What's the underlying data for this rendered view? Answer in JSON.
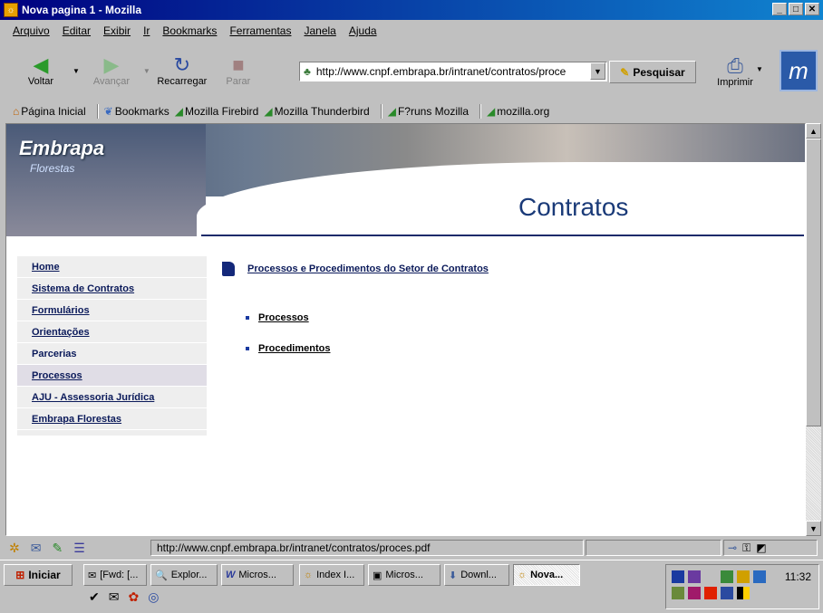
{
  "window": {
    "title": "Nova pagina 1 - Mozilla",
    "min": "_",
    "max": "□",
    "close": "✕"
  },
  "menu": [
    "Arquivo",
    "Editar",
    "Exibir",
    "Ir",
    "Bookmarks",
    "Ferramentas",
    "Janela",
    "Ajuda"
  ],
  "toolbar": {
    "back": "Voltar",
    "forward": "Avançar",
    "reload": "Recarregar",
    "stop": "Parar",
    "search": "Pesquisar",
    "print": "Imprimir"
  },
  "address": {
    "url": "http://www.cnpf.embrapa.br/intranet/contratos/proce"
  },
  "personal": [
    "Página Inicial",
    "Bookmarks",
    "Mozilla Firebird",
    "Mozilla Thunderbird",
    "F?runs Mozilla",
    "mozilla.org"
  ],
  "page": {
    "brand": "Embrapa",
    "brand_sub": "Florestas",
    "title": "Contratos",
    "nav": [
      "Home",
      "Sistema de Contratos",
      "Formulários",
      "Orientações",
      "Parcerias",
      "Processos",
      "AJU - Assessoria Jurídica",
      "Embrapa Florestas"
    ],
    "section_title": "Processos e Procedimentos do Setor de Contratos",
    "links": [
      "Processos",
      "Procedimentos"
    ]
  },
  "status": {
    "text": "http://www.cnpf.embrapa.br/intranet/contratos/proces.pdf"
  },
  "taskbar": {
    "start": "Iniciar",
    "tasks": [
      "[Fwd: [...",
      "Explor...",
      "Micros...",
      "Index I...",
      "Micros...",
      "Downl...",
      "Nova..."
    ],
    "clock": "11:32"
  }
}
